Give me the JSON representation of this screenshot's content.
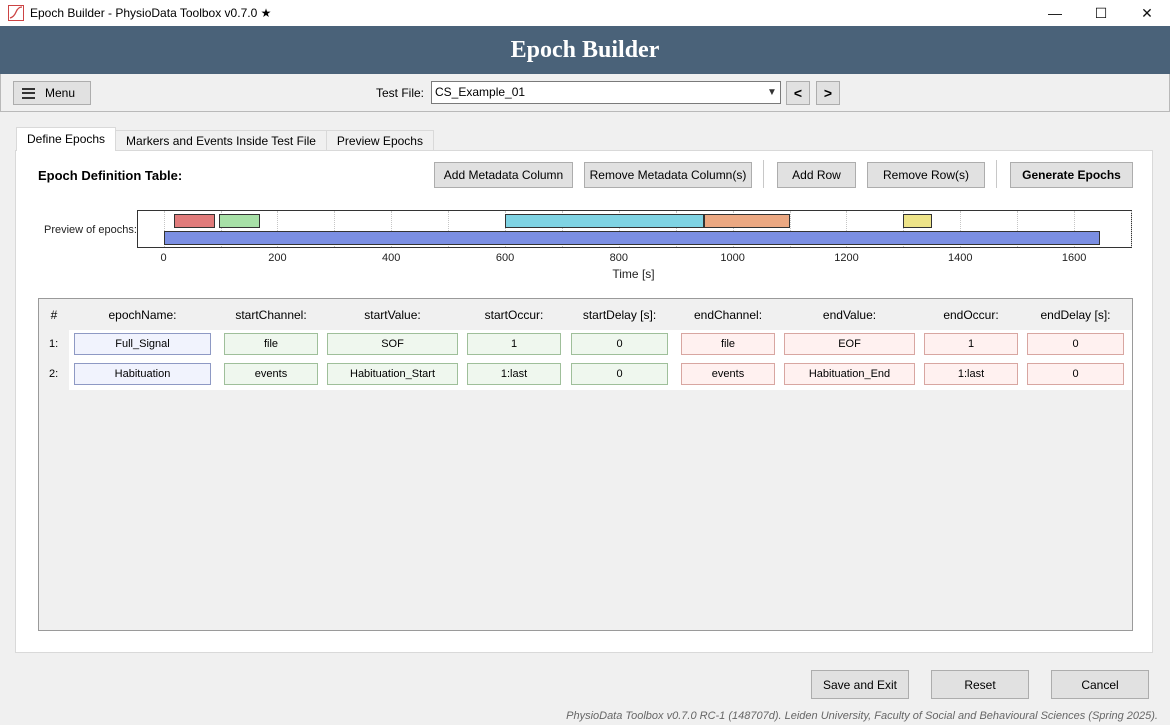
{
  "window": {
    "title": "Epoch Builder - PhysioData Toolbox v0.7.0 ★",
    "minimize": "—",
    "maximize": "☐",
    "close": "✕"
  },
  "header": {
    "title": "Epoch Builder"
  },
  "toolbar": {
    "menu_label": "Menu",
    "test_file_label": "Test File:",
    "test_file_value": "CS_Example_01",
    "prev_label": "<",
    "next_label": ">"
  },
  "tabs": [
    {
      "label": "Define Epochs",
      "active": true
    },
    {
      "label": "Markers and Events Inside Test File",
      "active": false
    },
    {
      "label": "Preview Epochs",
      "active": false
    }
  ],
  "panel": {
    "title": "Epoch Definition Table:",
    "buttons": {
      "add_metadata": "Add Metadata Column",
      "remove_metadata": "Remove Metadata Column(s)",
      "add_row": "Add Row",
      "remove_row": "Remove Row(s)",
      "generate": "Generate Epochs"
    }
  },
  "preview": {
    "label": "Preview of epochs:",
    "axis_label": "Time [s]",
    "ticks": [
      "0",
      "200",
      "400",
      "600",
      "800",
      "1000",
      "1200",
      "1400",
      "1600"
    ],
    "xlim": [
      -45,
      1700
    ],
    "epochs": [
      {
        "start": 18,
        "end": 90,
        "lane": 0,
        "color": "#e07b7b"
      },
      {
        "start": 98,
        "end": 170,
        "lane": 0,
        "color": "#a7e0a7"
      },
      {
        "start": 600,
        "end": 950,
        "lane": 0,
        "color": "#7fd3e3"
      },
      {
        "start": 950,
        "end": 1100,
        "lane": 0,
        "color": "#eba882"
      },
      {
        "start": 1300,
        "end": 1350,
        "lane": 0,
        "color": "#eee489"
      },
      {
        "start": 0,
        "end": 1645,
        "lane": 1,
        "color": "#7b8fe3"
      }
    ]
  },
  "table": {
    "hash_label": "#",
    "columns": [
      "epochName:",
      "startChannel:",
      "startValue:",
      "startOccur:",
      "startDelay [s]:",
      "endChannel:",
      "endValue:",
      "endOccur:",
      "endDelay [s]:"
    ],
    "rows": [
      {
        "label": "1:",
        "cells": [
          "Full_Signal",
          "file",
          "SOF",
          "1",
          "0",
          "file",
          "EOF",
          "1",
          "0"
        ]
      },
      {
        "label": "2:",
        "cells": [
          "Habituation",
          "events",
          "Habituation_Start",
          "1:last",
          "0",
          "events",
          "Habituation_End",
          "1:last",
          "0"
        ]
      }
    ]
  },
  "bottom": {
    "save_exit": "Save and Exit",
    "reset": "Reset",
    "cancel": "Cancel"
  },
  "footer": "PhysioData Toolbox v0.7.0 RC-1 (148707d). Leiden University, Faculty of Social and Behavioural Sciences (Spring 2025)."
}
